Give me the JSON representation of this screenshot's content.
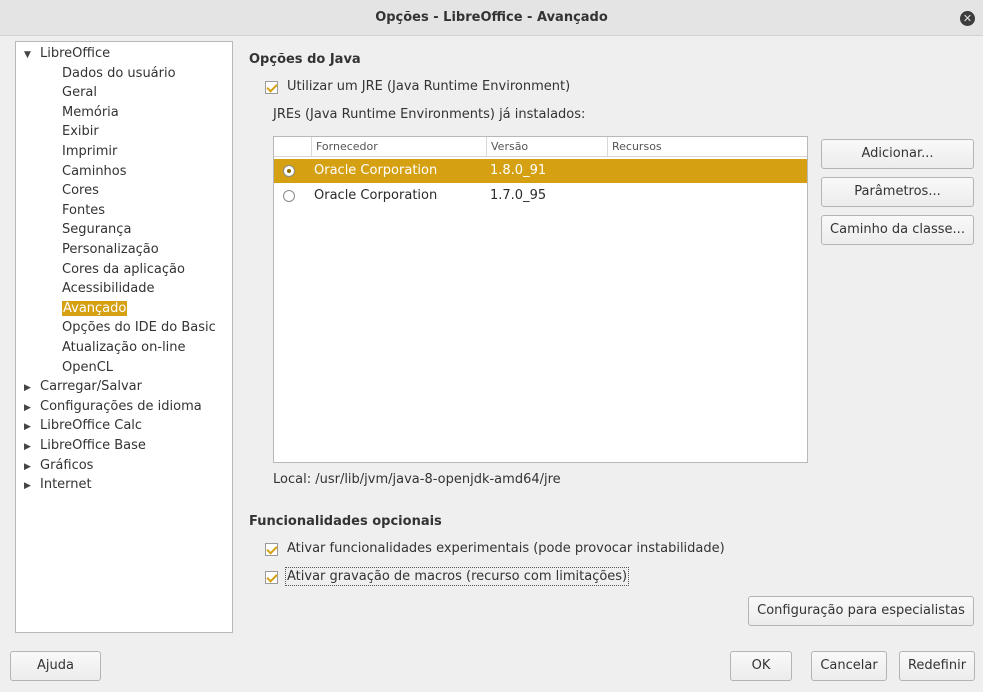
{
  "window": {
    "title": "Opções - LibreOffice - Avançado"
  },
  "tree": {
    "items": [
      {
        "label": "LibreOffice",
        "level": 0,
        "expanded": true
      },
      {
        "label": "Dados do usuário",
        "level": 1
      },
      {
        "label": "Geral",
        "level": 1
      },
      {
        "label": "Memória",
        "level": 1
      },
      {
        "label": "Exibir",
        "level": 1
      },
      {
        "label": "Imprimir",
        "level": 1
      },
      {
        "label": "Caminhos",
        "level": 1
      },
      {
        "label": "Cores",
        "level": 1
      },
      {
        "label": "Fontes",
        "level": 1
      },
      {
        "label": "Segurança",
        "level": 1
      },
      {
        "label": "Personalização",
        "level": 1
      },
      {
        "label": "Cores da aplicação",
        "level": 1
      },
      {
        "label": "Acessibilidade",
        "level": 1
      },
      {
        "label": "Avançado",
        "level": 1,
        "selected": true
      },
      {
        "label": "Opções do IDE do Basic",
        "level": 1
      },
      {
        "label": "Atualização on-line",
        "level": 1
      },
      {
        "label": "OpenCL",
        "level": 1
      },
      {
        "label": "Carregar/Salvar",
        "level": 0,
        "expanded": false
      },
      {
        "label": "Configurações de idioma",
        "level": 0,
        "expanded": false
      },
      {
        "label": "LibreOffice Calc",
        "level": 0,
        "expanded": false
      },
      {
        "label": "LibreOffice Base",
        "level": 0,
        "expanded": false
      },
      {
        "label": "Gráficos",
        "level": 0,
        "expanded": false
      },
      {
        "label": "Internet",
        "level": 0,
        "expanded": false
      }
    ]
  },
  "java": {
    "section_title": "Opções do Java",
    "use_jre_label": "Utilizar um JRE (Java Runtime Environment)",
    "use_jre_checked": true,
    "installed_label": "JREs (Java Runtime Environments) já instalados:",
    "columns": [
      "Fornecedor",
      "Versão",
      "Recursos"
    ],
    "rows": [
      {
        "vendor": "Oracle Corporation",
        "version": "1.8.0_91",
        "features": "",
        "selected": true
      },
      {
        "vendor": "Oracle Corporation",
        "version": "1.7.0_95",
        "features": "",
        "selected": false
      }
    ],
    "location": "Local: /usr/lib/jvm/java-8-openjdk-amd64/jre",
    "buttons": {
      "add": "Adicionar...",
      "parameters": "Parâmetros...",
      "classpath": "Caminho da classe..."
    }
  },
  "optional": {
    "section_title": "Funcionalidades opcionais",
    "experimental_label": "Ativar funcionalidades experimentais (pode provocar instabilidade)",
    "experimental_checked": true,
    "macro_label": "Ativar gravação de macros (recurso com limitações)",
    "macro_checked": true,
    "expert_button": "Configuração para especialistas"
  },
  "footer": {
    "help": "Ajuda",
    "ok": "OK",
    "cancel": "Cancelar",
    "reset": "Redefinir"
  },
  "colors": {
    "accent": "#d5a011"
  }
}
